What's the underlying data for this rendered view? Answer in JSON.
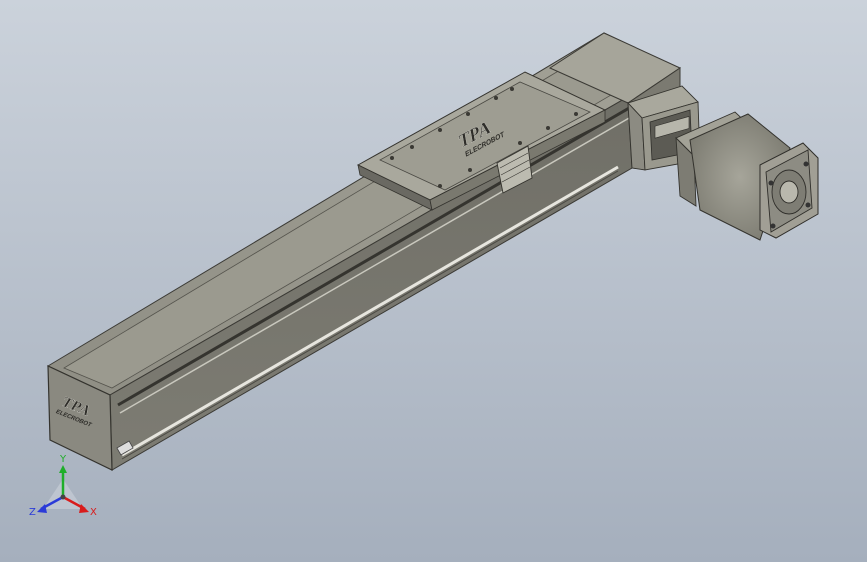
{
  "viewport": {
    "background_top": "#c9d0d9",
    "background_bottom": "#a7b1bf"
  },
  "model": {
    "logo_text": "TPA",
    "brand_text": "ELECROBOT",
    "body_color": "#8e8d83",
    "body_dark": "#5f5e57",
    "body_light": "#b0aea3"
  },
  "triad": {
    "x_label": "X",
    "y_label": "Y",
    "z_label": "Z",
    "x_color": "#d81c1c",
    "y_color": "#1fae2a",
    "z_color": "#2b3bd8"
  }
}
